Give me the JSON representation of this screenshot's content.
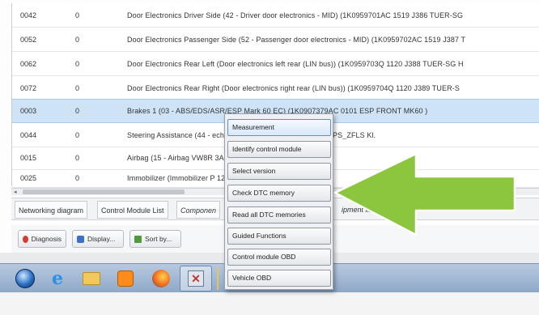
{
  "table": {
    "rows": [
      {
        "address": "0042",
        "faults": "0",
        "description": "Door Electronics Driver Side (42 - Driver door electronics - MID) (1K0959701AC  1519  J386  TUER-SG"
      },
      {
        "address": "0052",
        "faults": "0",
        "description": "Door Electronics Passenger Side (52 - Passenger door electronics - MID) (1K0959702AC  1519  J387  T"
      },
      {
        "address": "0062",
        "faults": "0",
        "description": "Door Electronics Rear Left (Door electronics left rear (LIN bus)) (1K0959703Q  1120  J388  TUER-SG H"
      },
      {
        "address": "0072",
        "faults": "0",
        "description": "Door Electronics Rear Right (Door electronics right rear (LIN bus)) (1K0959704Q  1120  J389  TUER-S"
      },
      {
        "address": "0003",
        "faults": "0",
        "description": "Brakes 1 (03 - ABS/EDS/ASR/ESP Mark 60 EC) (1K0907379AC  0101  ESP FRONT MK60  )"
      },
      {
        "address": "0044",
        "faults": "0",
        "description": "Steering Assistance (44 -                          ech. (Gen. 2)) (1K1909144M  1901  EPS_ZFLS Kl."
      },
      {
        "address": "0015",
        "faults": "0",
        "description": "Airbag (15 - Airbag VW8R                          3A AIRBAG VW8R 09)"
      },
      {
        "address": "0025",
        "faults": "0",
        "description": "Immobilizer (Immobilizer                           P    1222"
      }
    ]
  },
  "tabs": [
    "Networking diagram",
    "Control Module List",
    "Componen",
    "ipment lis"
  ],
  "toolbar": {
    "diagnosis": "Diagnosis",
    "display": "Display...",
    "sort": "Sort by..."
  },
  "context_menu": {
    "items": [
      "Measurement",
      "Identify control module",
      "Select version",
      "Check DTC memory",
      "Read all DTC memories",
      "Guided Functions",
      "Control module OBD",
      "Vehicle OBD"
    ]
  },
  "colors": {
    "selected_row": "#cfe3f7",
    "arrow": "#8cc63e",
    "taskbar": "#9fb6d3"
  },
  "taskbar": {
    "icons": [
      "windows-start-icon",
      "internet-explorer-icon",
      "folder-icon",
      "media-player-icon",
      "firefox-icon",
      "vas-diagnostic-icon"
    ]
  }
}
